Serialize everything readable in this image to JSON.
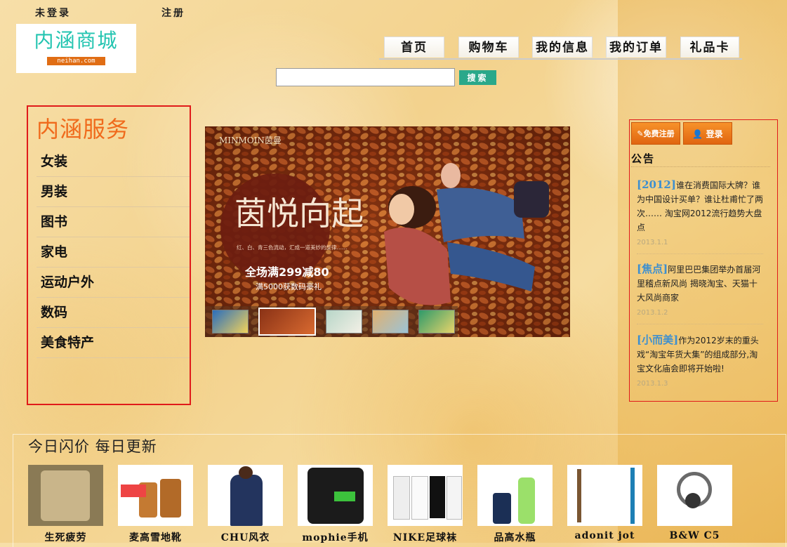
{
  "top": {
    "login_status": "未登录",
    "register": "注册"
  },
  "logo": {
    "title": "内涵商城",
    "subtitle": "neihan.com"
  },
  "nav": [
    "首页",
    "购物车",
    "我的信息",
    "我的订单",
    "礼品卡"
  ],
  "search": {
    "placeholder": "",
    "button": "搜索"
  },
  "service": {
    "title": "内涵服务",
    "items": [
      "女装",
      "男装",
      "图书",
      "家电",
      "运动户外",
      "数码",
      "美食特产"
    ]
  },
  "banner": {
    "brand": "MINMOIN茵曼",
    "headline": "茵悦向起",
    "caption": "红、白、青三色流动，汇成一道美妙的旋律……",
    "promo": "全场满299减80",
    "promo_sub": "满5000获数码豪礼"
  },
  "account": {
    "register_button": "免费注册",
    "login_button": "登录"
  },
  "notice": {
    "title": "公告",
    "items": [
      {
        "tag": "[2012]",
        "text": "谁在消费国际大牌？谁为中国设计买单？谁让杜甫忙了两次…… 淘宝网2012流行趋势大盘点",
        "date": "2013.1.1"
      },
      {
        "tag": "[焦点]",
        "text": "阿里巴巴集团举办首届河里稽点新风尚 揭晓淘宝、天猫十大风尚商家",
        "date": "2013.1.2"
      },
      {
        "tag": "[小而美]",
        "text": "作为2012岁末的重头戏“淘宝年货大集”的组成部分,淘宝文化庙会即将开始啦!",
        "date": "2013.1.3"
      }
    ]
  },
  "flash": {
    "title": "今日闪价 每日更新",
    "products": [
      {
        "name": "生死疲劳"
      },
      {
        "name": "麦高雪地靴"
      },
      {
        "name": "CHU风衣"
      },
      {
        "name": "mophie手机"
      },
      {
        "name": "NIKE足球袜"
      },
      {
        "name": "品高水瓶"
      },
      {
        "name": "adonit jot"
      },
      {
        "name": "B&W C5"
      }
    ]
  }
}
